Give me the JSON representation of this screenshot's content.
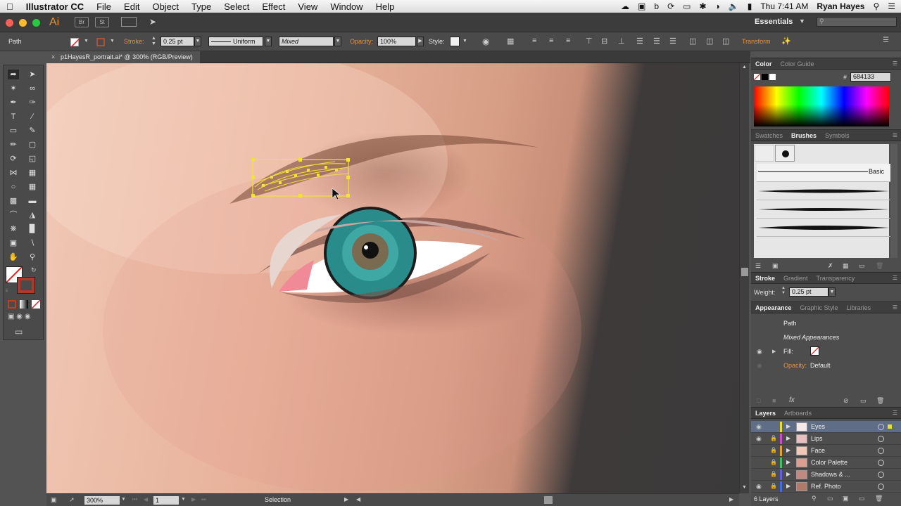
{
  "menubar": {
    "app": "Illustrator CC",
    "items": [
      "File",
      "Edit",
      "Object",
      "Type",
      "Select",
      "Effect",
      "View",
      "Window",
      "Help"
    ],
    "clock": "Thu 7:41 AM",
    "user": "Ryan Hayes"
  },
  "appbar": {
    "logo": "Ai",
    "bridge": "Br",
    "stock": "St",
    "workspace": "Essentials"
  },
  "control": {
    "selection_type": "Path",
    "stroke_label": "Stroke:",
    "stroke_value": "0.25 pt",
    "profile": "Uniform",
    "brush": "Mixed",
    "opacity_label": "Opacity:",
    "opacity_value": "100%",
    "style_label": "Style:",
    "transform": "Transform"
  },
  "document": {
    "tab_title": "p1HayesR_portrait.ai* @ 300% (RGB/Preview)",
    "zoom": "300%",
    "artboard": "1",
    "status": "Selection"
  },
  "color_panel": {
    "tabs": [
      "Color",
      "Color Guide"
    ],
    "hex_label": "#",
    "hex_value": "684133"
  },
  "brushes_panel": {
    "tabs": [
      "Swatches",
      "Brushes",
      "Symbols"
    ],
    "basic_label": "Basic"
  },
  "stroke_panel": {
    "tabs": [
      "Stroke",
      "Gradient",
      "Transparency"
    ],
    "weight_label": "Weight:",
    "weight_value": "0.25 pt"
  },
  "appearance_panel": {
    "tabs": [
      "Appearance",
      "Graphic Style",
      "Libraries"
    ],
    "path": "Path",
    "mixed": "Mixed Appearances",
    "fill_label": "Fill:",
    "opacity_label": "Opacity:",
    "opacity_value": "Default"
  },
  "layers_panel": {
    "tabs": [
      "Layers",
      "Artboards"
    ],
    "layers": [
      {
        "name": "Eyes",
        "color": "#e8e030",
        "visible": true,
        "locked": false
      },
      {
        "name": "Lips",
        "color": "#d04ad0",
        "visible": true,
        "locked": true
      },
      {
        "name": "Face",
        "color": "#e0a040",
        "visible": false,
        "locked": true
      },
      {
        "name": "Color Palette",
        "color": "#40c060",
        "visible": false,
        "locked": true
      },
      {
        "name": "Shadows & ...",
        "color": "#6060e0",
        "visible": false,
        "locked": true
      },
      {
        "name": "Ref. Photo",
        "color": "#4070e0",
        "visible": true,
        "locked": true
      }
    ],
    "count": "6 Layers"
  },
  "colors": {
    "accent_orange": "#e8923a",
    "selection_yellow": "#f2e23a"
  }
}
